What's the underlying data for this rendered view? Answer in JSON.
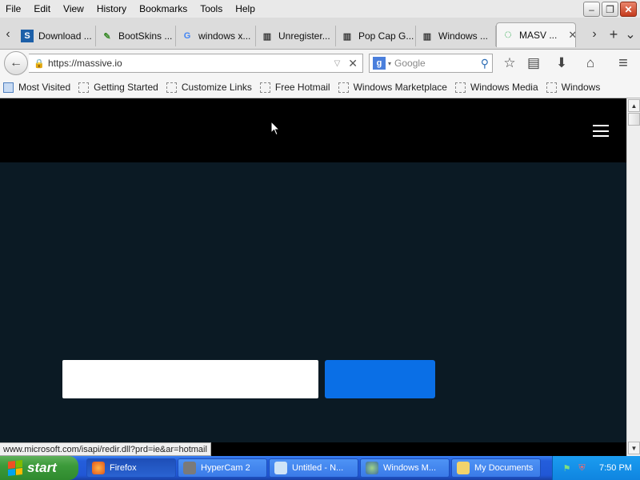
{
  "menu": [
    "File",
    "Edit",
    "View",
    "History",
    "Bookmarks",
    "Tools",
    "Help"
  ],
  "window_buttons": {
    "minimize": "–",
    "restore": "❐",
    "close": "✕"
  },
  "tabs": [
    {
      "label": "Download ...",
      "icon": "download-site-icon",
      "glyph": "S",
      "color": "#1c5fa8"
    },
    {
      "label": "BootSkins ...",
      "icon": "bootskins-icon",
      "glyph": "✎",
      "color": "#3a8a2a"
    },
    {
      "label": "windows x...",
      "icon": "google-icon",
      "glyph": "G",
      "color": "#4285f4"
    },
    {
      "label": "Unregister...",
      "icon": "library-icon",
      "glyph": "▥",
      "color": "#333333"
    },
    {
      "label": "Pop Cap G...",
      "icon": "library-icon",
      "glyph": "▥",
      "color": "#333333"
    },
    {
      "label": "Windows ...",
      "icon": "library-icon",
      "glyph": "▥",
      "color": "#333333"
    },
    {
      "label": "MASV ...",
      "icon": "loading-spinner-icon",
      "glyph": "◌",
      "color": "#2aa84a",
      "active": true
    }
  ],
  "tab_controls": {
    "scroll_left": "‹",
    "scroll_right": "›",
    "new_tab": "+",
    "list_all": "⌄",
    "close": "✕"
  },
  "urlbar": {
    "url": "https://massive.io",
    "lock": "🔒",
    "dropdown": "▽",
    "clear": "✕"
  },
  "search": {
    "engine_glyph": "g",
    "placeholder": "Google",
    "dropdown": "▾",
    "magnifier": "⚲"
  },
  "nav_icons": {
    "back": "←",
    "bookmark_star": "☆",
    "reading_list": "▤",
    "downloads": "⬇",
    "home": "⌂",
    "menu": "≡"
  },
  "bookmarks": [
    "Most Visited",
    "Getting Started",
    "Customize Links",
    "Free Hotmail",
    "Windows Marketplace",
    "Windows Media",
    "Windows"
  ],
  "scrollbar": {
    "up": "▲",
    "down": "▼"
  },
  "status_url": "www.microsoft.com/isapi/redir.dll?prd=ie&ar=hotmail",
  "site": {
    "accent_color": "#0a6fe6",
    "header_color": "#000000",
    "body_color": "#0b1a24"
  },
  "taskbar": {
    "start_label": "start",
    "tasks": [
      {
        "label": "Firefox",
        "icon": "firefox-icon",
        "active": true
      },
      {
        "label": "HyperCam 2",
        "icon": "hypercam-icon"
      },
      {
        "label": "Untitled - N...",
        "icon": "notepad-icon"
      },
      {
        "label": "Windows M...",
        "icon": "media-player-icon"
      },
      {
        "label": "My Documents",
        "icon": "folder-icon"
      }
    ],
    "clock": "7:50 PM"
  }
}
